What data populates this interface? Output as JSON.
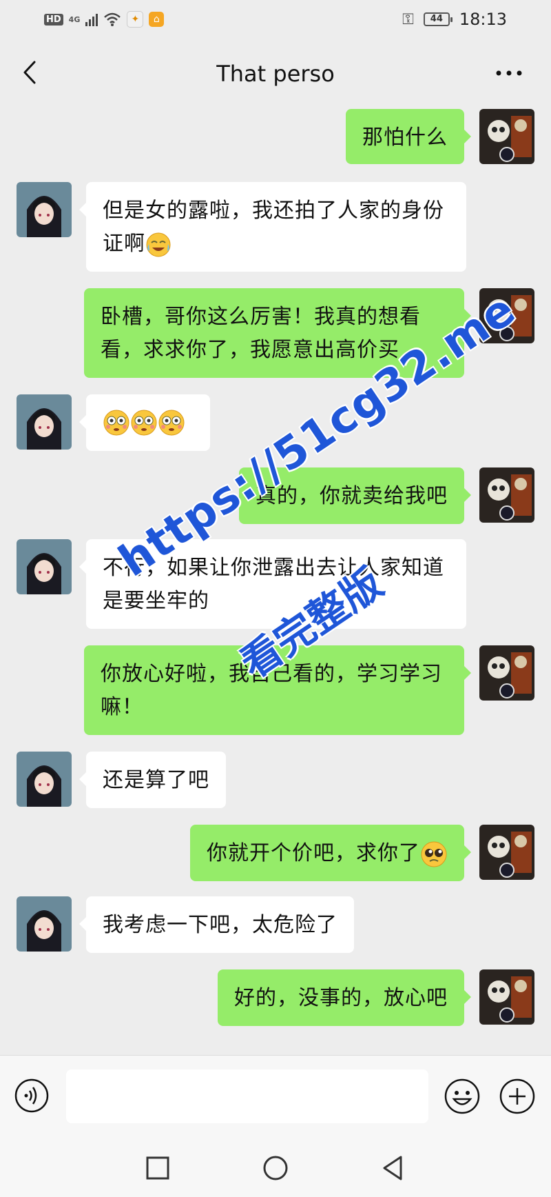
{
  "status_bar": {
    "hd": "HD",
    "network": "4G",
    "battery": "44",
    "time": "18:13"
  },
  "header": {
    "title": "That perso"
  },
  "messages": [
    {
      "side": "out",
      "text": "那怕什么"
    },
    {
      "side": "in",
      "text": "但是女的露啦，我还拍了人家的身份证啊",
      "emoji": "tears-of-joy-emoji"
    },
    {
      "side": "out",
      "text": "卧槽，哥你这么厉害！我真的想看看，求求你了，我愿意出高价买"
    },
    {
      "side": "in",
      "text": "",
      "emoji": "flushed-emoji x3"
    },
    {
      "side": "out",
      "text": "真的，你就卖给我吧"
    },
    {
      "side": "in",
      "text": "不行，如果让你泄露出去让人家知道是要坐牢的"
    },
    {
      "side": "out",
      "text": "你放心好啦，我自己看的，学习学习嘛！"
    },
    {
      "side": "in",
      "text": "还是算了吧"
    },
    {
      "side": "out",
      "text": "你就开个价吧，求你了",
      "emoji": "pleading-emoji"
    },
    {
      "side": "in",
      "text": "我考虑一下吧，太危险了"
    },
    {
      "side": "out",
      "text": "好的，没事的，放心吧"
    }
  ],
  "watermark": {
    "line1": "https://51cg32.me",
    "line2": "看完整版"
  },
  "input_bar": {
    "placeholder": ""
  },
  "colors": {
    "background": "#ededed",
    "bubble_out": "#95ec69",
    "bubble_in": "#ffffff",
    "watermark": "#1f56d8"
  }
}
